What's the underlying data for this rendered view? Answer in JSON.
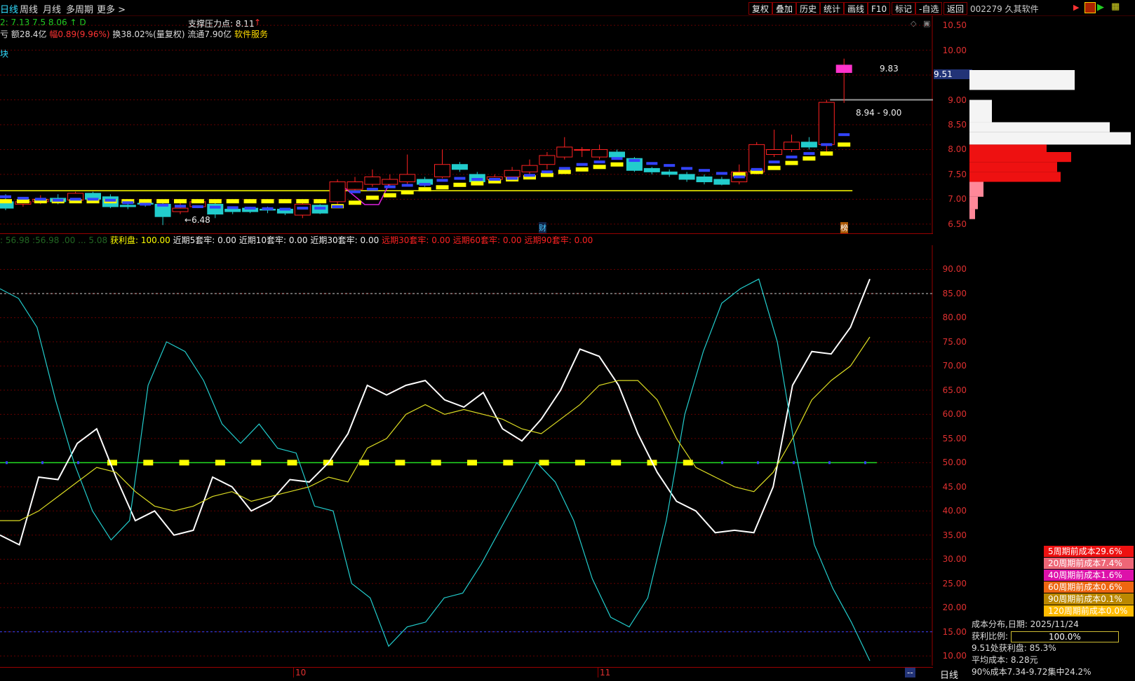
{
  "toolbar": {
    "period_tabs": [
      "日线",
      "周线",
      "月线",
      "多周期",
      "更多"
    ],
    "more_chevron": "chevron-right-icon",
    "buttons": [
      "复权",
      "叠加",
      "历史",
      "统计",
      "画线",
      "F10",
      "标记",
      "-自选",
      "返回"
    ]
  },
  "stock": {
    "code_name": "002279 久其软件"
  },
  "header": {
    "line1_left": "2: 7.13   7.5  8.06 ↑  D",
    "support_label": "支撑压力点: 8.11",
    "arrow": "↑",
    "line2_amount": "亏 额28.4亿",
    "line2_change_label": "幅",
    "line2_change_value": "0.89(9.96%)",
    "line2_turnover": "换38.02%(量复权)",
    "line2_float": "流通7.90亿",
    "line2_sector": "软件服务",
    "line3": "块"
  },
  "price_axis": {
    "labels": [
      "10.50",
      "10.00",
      "9.50",
      "9.00",
      "8.50",
      "8.00",
      "7.50",
      "7.00",
      "6.50"
    ],
    "current_price": "9.51"
  },
  "candle_annotations": {
    "high_label": "9.83",
    "range_label": "8.94 - 9.00",
    "low_label": "6.48",
    "low_arrow": "←",
    "finance_marker": "财",
    "rank_marker": "榜"
  },
  "oscillator_header": {
    "hidden_prefix": ": 56.98  :56.98    .00  ... 5.08",
    "profit_label": "获利盘:",
    "profit_value": "100.00",
    "items_white": [
      "近期5套牢: 0.00",
      "近期10套牢: 0.00",
      "近期30套牢: 0.00"
    ],
    "items_red": [
      "远期30套牢: 0.00",
      "远期60套牢: 0.00",
      "远期90套牢: 0.00"
    ]
  },
  "osc_axis": {
    "labels": [
      "90.00",
      "85.00",
      "80.00",
      "75.00",
      "70.00",
      "65.00",
      "60.00",
      "55.00",
      "50.00",
      "45.00",
      "40.00",
      "35.00",
      "30.00",
      "25.00",
      "20.00",
      "15.00",
      "10.00"
    ]
  },
  "x_axis": {
    "labels": [
      "10",
      "11"
    ],
    "period_label": "日线",
    "scroll_label": "--"
  },
  "legend": [
    {
      "text": "5周期前成本29.6%",
      "color": "#ee1111"
    },
    {
      "text": "20周期前成本7.4%",
      "color": "#ee6677"
    },
    {
      "text": "40周期前成本1.6%",
      "color": "#dd11aa"
    },
    {
      "text": "60周期前成本0.6%",
      "color": "#ee6611"
    },
    {
      "text": "90周期前成本0.1%",
      "color": "#bb8800"
    },
    {
      "text": "120周期前成本0.0%",
      "color": "#ffbb00"
    }
  ],
  "cost_info": {
    "date_line": "成本分布,日期:  2025/11/24",
    "ratio_label": "获利比例:",
    "ratio_value": "100.0%",
    "ratio_fraction": 1.0,
    "profit_at": "9.51处获利盘:  85.3%",
    "avg_cost": "平均成本:  8.28元",
    "concentration": "90%成本7.34-9.72集中24.2%"
  },
  "colors": {
    "up": "#ff2222",
    "down": "#22cccc",
    "ma_yellow": "#ffff00",
    "ma_blue": "#3344ff",
    "line_white": "#ffffff",
    "line_cyan": "#22cccc",
    "line_yellow": "#dddd22",
    "grid": "#660000"
  },
  "chart_data": [
    {
      "type": "candlestick",
      "ylim": [
        6.3,
        10.7
      ],
      "candles": [
        {
          "o": 6.95,
          "c": 6.82,
          "h": 7.1,
          "l": 6.78
        },
        {
          "o": 6.9,
          "c": 6.95,
          "h": 7.0,
          "l": 6.85
        },
        {
          "o": 6.95,
          "c": 7.0,
          "h": 7.08,
          "l": 6.9
        },
        {
          "o": 7.02,
          "c": 6.95,
          "h": 7.1,
          "l": 6.9
        },
        {
          "o": 6.98,
          "c": 7.12,
          "h": 7.15,
          "l": 6.95
        },
        {
          "o": 7.12,
          "c": 7.0,
          "h": 7.15,
          "l": 6.98
        },
        {
          "o": 7.05,
          "c": 6.85,
          "h": 7.1,
          "l": 6.82
        },
        {
          "o": 6.88,
          "c": 6.85,
          "h": 6.95,
          "l": 6.8
        },
        {
          "o": 6.92,
          "c": 6.9,
          "h": 6.95,
          "l": 6.85
        },
        {
          "o": 6.9,
          "c": 6.65,
          "h": 6.95,
          "l": 6.48
        },
        {
          "o": 6.75,
          "c": 6.82,
          "h": 6.95,
          "l": 6.7
        },
        {
          "o": 6.85,
          "c": 6.95,
          "h": 7.0,
          "l": 6.82
        },
        {
          "o": 6.9,
          "c": 6.7,
          "h": 6.92,
          "l": 6.62
        },
        {
          "o": 6.8,
          "c": 6.75,
          "h": 6.85,
          "l": 6.7
        },
        {
          "o": 6.82,
          "c": 6.75,
          "h": 6.85,
          "l": 6.72
        },
        {
          "o": 6.8,
          "c": 6.78,
          "h": 6.85,
          "l": 6.72
        },
        {
          "o": 6.8,
          "c": 6.72,
          "h": 6.82,
          "l": 6.68
        },
        {
          "o": 6.68,
          "c": 6.9,
          "h": 7.0,
          "l": 6.62
        },
        {
          "o": 6.88,
          "c": 6.72,
          "h": 6.9,
          "l": 6.7
        },
        {
          "o": 6.95,
          "c": 7.35,
          "h": 7.4,
          "l": 6.9
        },
        {
          "o": 7.2,
          "c": 7.35,
          "h": 7.45,
          "l": 7.15
        },
        {
          "o": 7.3,
          "c": 7.45,
          "h": 7.6,
          "l": 7.25
        },
        {
          "o": 7.3,
          "c": 7.4,
          "h": 7.5,
          "l": 7.25
        },
        {
          "o": 7.35,
          "c": 7.5,
          "h": 7.9,
          "l": 7.3
        },
        {
          "o": 7.4,
          "c": 7.3,
          "h": 7.45,
          "l": 7.25
        },
        {
          "o": 7.45,
          "c": 7.7,
          "h": 8.0,
          "l": 7.42
        },
        {
          "o": 7.7,
          "c": 7.6,
          "h": 7.75,
          "l": 7.55
        },
        {
          "o": 7.5,
          "c": 7.35,
          "h": 7.55,
          "l": 7.3
        },
        {
          "o": 7.4,
          "c": 7.45,
          "h": 7.5,
          "l": 7.35
        },
        {
          "o": 7.45,
          "c": 7.58,
          "h": 7.65,
          "l": 7.4
        },
        {
          "o": 7.55,
          "c": 7.68,
          "h": 7.8,
          "l": 7.5
        },
        {
          "o": 7.7,
          "c": 7.88,
          "h": 7.95,
          "l": 7.6
        },
        {
          "o": 7.85,
          "c": 8.05,
          "h": 8.25,
          "l": 7.8
        },
        {
          "o": 8.0,
          "c": 8.0,
          "h": 8.05,
          "l": 7.85
        },
        {
          "o": 7.85,
          "c": 8.0,
          "h": 8.1,
          "l": 7.8
        },
        {
          "o": 7.95,
          "c": 7.85,
          "h": 8.0,
          "l": 7.8
        },
        {
          "o": 7.82,
          "c": 7.58,
          "h": 7.85,
          "l": 7.55
        },
        {
          "o": 7.62,
          "c": 7.55,
          "h": 7.65,
          "l": 7.5
        },
        {
          "o": 7.55,
          "c": 7.5,
          "h": 7.6,
          "l": 7.45
        },
        {
          "o": 7.5,
          "c": 7.4,
          "h": 7.55,
          "l": 7.35
        },
        {
          "o": 7.45,
          "c": 7.35,
          "h": 7.5,
          "l": 7.3
        },
        {
          "o": 7.4,
          "c": 7.3,
          "h": 7.45,
          "l": 7.28
        },
        {
          "o": 7.35,
          "c": 7.55,
          "h": 7.7,
          "l": 7.3
        },
        {
          "o": 7.55,
          "c": 8.1,
          "h": 8.15,
          "l": 7.5
        },
        {
          "o": 7.9,
          "c": 8.0,
          "h": 8.4,
          "l": 7.85
        },
        {
          "o": 8.0,
          "c": 8.15,
          "h": 8.3,
          "l": 7.95
        },
        {
          "o": 8.15,
          "c": 8.05,
          "h": 8.25,
          "l": 8.0
        },
        {
          "o": 8.1,
          "c": 8.95,
          "h": 9.0,
          "l": 7.95
        },
        {
          "o": 9.55,
          "c": 9.7,
          "h": 9.83,
          "l": 8.94
        }
      ],
      "ma_yellow": [
        6.96,
        6.96,
        6.96,
        6.96,
        6.96,
        6.96,
        6.96,
        6.96,
        6.96,
        6.96,
        6.96,
        6.96,
        6.96,
        6.96,
        6.96,
        6.96,
        6.96,
        6.96,
        6.96,
        6.86,
        6.93,
        7.03,
        7.08,
        7.14,
        7.2,
        7.24,
        7.29,
        7.32,
        7.36,
        7.4,
        7.44,
        7.49,
        7.55,
        7.6,
        7.65,
        7.7,
        null,
        null,
        null,
        null,
        null,
        null,
        7.5,
        7.55,
        7.63,
        7.73,
        7.82,
        7.92,
        8.1
      ],
      "ma_blue": [
        7.05,
        7.02,
        7.0,
        6.98,
        7.0,
        7.0,
        6.98,
        6.93,
        6.9,
        6.88,
        6.86,
        6.85,
        6.84,
        6.83,
        6.82,
        6.81,
        6.8,
        6.82,
        6.82,
        6.85,
        7.15,
        7.2,
        7.25,
        7.28,
        7.3,
        7.38,
        7.42,
        7.4,
        7.4,
        7.42,
        7.48,
        7.55,
        7.62,
        7.7,
        7.75,
        7.82,
        7.78,
        7.72,
        7.68,
        7.62,
        7.58,
        7.52,
        7.45,
        7.6,
        7.75,
        7.85,
        7.92,
        8.1,
        8.3
      ],
      "support_level": 7.17
    },
    {
      "type": "line",
      "ylim": [
        8,
        95
      ],
      "series": [
        {
          "color": "#ffffff",
          "values": [
            35,
            33,
            47,
            46.5,
            54,
            57,
            47,
            38,
            40,
            35,
            36,
            47,
            45,
            40,
            42,
            46.5,
            46,
            50,
            56,
            66,
            64,
            66,
            67,
            63,
            61.5,
            64.5,
            57,
            54.5,
            59,
            65,
            73.5,
            72,
            66,
            56,
            48,
            42,
            40,
            35.5,
            36,
            35.5,
            45,
            66,
            73,
            72.5,
            78,
            88
          ]
        },
        {
          "color": "#22cccc",
          "values": [
            86,
            84,
            78,
            63,
            50,
            40,
            34,
            38,
            66,
            75,
            73,
            67,
            58,
            54,
            58,
            53,
            52,
            41,
            40,
            25,
            22,
            12,
            16,
            17,
            22,
            23,
            29,
            36,
            43,
            50,
            46,
            38,
            26,
            18,
            16,
            22,
            38,
            60,
            73,
            83,
            86,
            88,
            75,
            52,
            33,
            24,
            17,
            9
          ]
        },
        {
          "color": "#dddd22",
          "values": [
            38,
            38,
            40,
            43,
            46,
            49,
            48,
            44,
            41,
            40,
            41,
            43,
            44,
            42,
            43,
            44,
            45,
            47,
            46,
            53,
            55,
            60,
            62,
            60,
            61,
            60,
            59,
            57,
            56,
            59,
            62,
            66,
            67,
            67,
            63,
            55,
            49,
            47,
            45,
            44,
            48,
            55,
            63,
            67,
            70,
            76
          ]
        }
      ]
    }
  ]
}
